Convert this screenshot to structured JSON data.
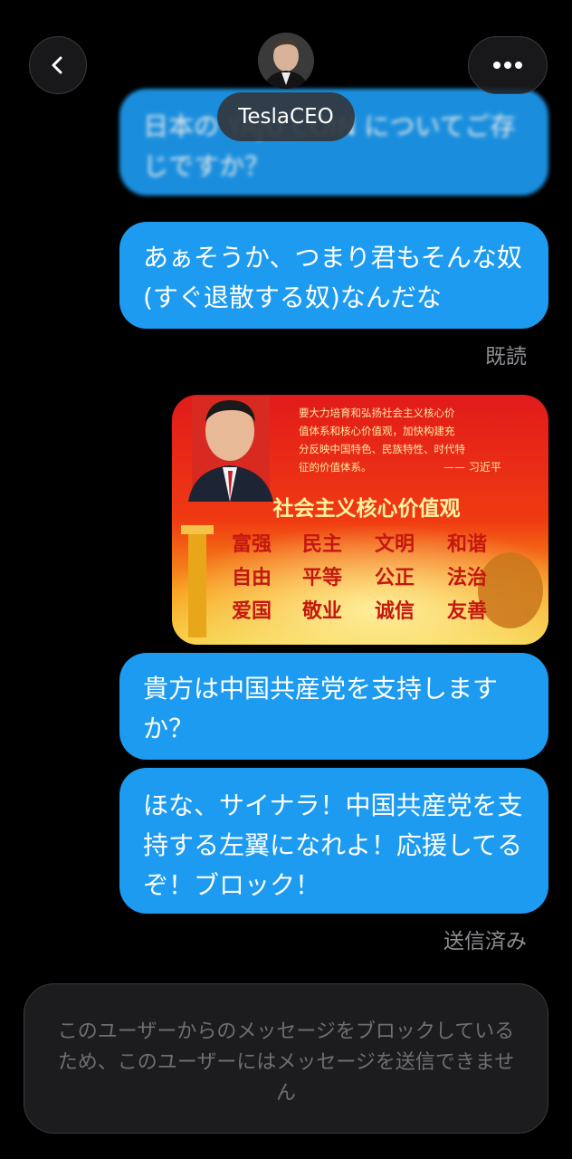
{
  "header": {
    "contact_name": "TeslaCEO",
    "back_icon": "chevron-left-icon",
    "more_icon": "more-horizontal-icon"
  },
  "messages": [
    {
      "text": "日本の YAJU COIN についてご存じですか？",
      "blurred": true
    },
    {
      "text": "あぁそうか、つまり君もそんな奴(すぐ退散する奴)なんだな"
    },
    {
      "image_caption": "社会主义核心价值观",
      "image_quote": "要大力培育和弘扬社会主义核心价值体系和核心价值观，加快构建充分反映中国特色、民族特性、时代特征的价值体系。",
      "image_signature": "—— 习近平",
      "image_values": [
        "富强",
        "民主",
        "文明",
        "和谐",
        "自由",
        "平等",
        "公正",
        "法治",
        "爱国",
        "敬业",
        "诚信",
        "友善"
      ]
    },
    {
      "text": "貴方は中国共産党を支持しますか？"
    },
    {
      "text": "ほな、サイナラ！中国共産党を支持する左翼になれよ！応援してるぞ！ブロック！"
    }
  ],
  "status": {
    "read": "既読",
    "sent": "送信済み"
  },
  "composer": {
    "blocked_notice": "このユーザーからのメッセージをブロックしているため、このユーザーにはメッセージを送信できません"
  },
  "colors": {
    "bubble": "#1d9bf0",
    "background": "#000000"
  }
}
